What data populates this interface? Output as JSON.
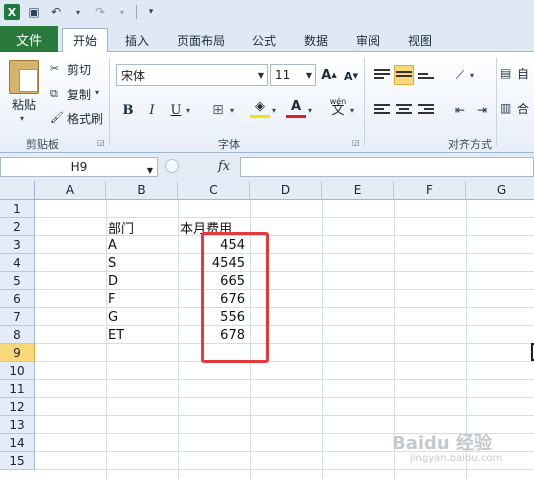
{
  "quick_access": {
    "app_icon": "X"
  },
  "tabs": [
    {
      "label": "文件"
    },
    {
      "label": "开始"
    },
    {
      "label": "插入"
    },
    {
      "label": "页面布局"
    },
    {
      "label": "公式"
    },
    {
      "label": "数据"
    },
    {
      "label": "审阅"
    },
    {
      "label": "视图"
    }
  ],
  "ribbon": {
    "clipboard": {
      "paste": "粘贴",
      "cut": "剪切",
      "copy": "复制",
      "format_painter": "格式刷",
      "group": "剪贴板"
    },
    "font": {
      "name": "宋体",
      "size": "11",
      "group": "字体",
      "bold": "B",
      "italic": "I",
      "underline": "U",
      "grow": "A",
      "shrink": "A",
      "wen": "wén",
      "wen_char": "文",
      "font_color": "A"
    },
    "alignment": {
      "group": "对齐方式",
      "auto": "自",
      "merge": "合"
    }
  },
  "formula_bar": {
    "name_box": "H9",
    "fx": "fx",
    "value": ""
  },
  "sheet": {
    "columns": [
      "A",
      "B",
      "C",
      "D",
      "E",
      "F",
      "G"
    ],
    "rows": [
      "1",
      "2",
      "3",
      "4",
      "5",
      "6",
      "7",
      "8",
      "9",
      "10",
      "11",
      "12",
      "13",
      "14",
      "15"
    ],
    "active_row": "9",
    "headers": {
      "dept": "部门",
      "cost": "本月费用"
    },
    "records": [
      {
        "dept": "A",
        "cost": "454"
      },
      {
        "dept": "S",
        "cost": "4545"
      },
      {
        "dept": "D",
        "cost": "665"
      },
      {
        "dept": "F",
        "cost": "676"
      },
      {
        "dept": "G",
        "cost": "556"
      },
      {
        "dept": "ET",
        "cost": "678"
      }
    ]
  },
  "watermark": {
    "brand": "Baidu 经验",
    "url": "jingyan.baidu.com"
  },
  "colors": {
    "highlight": "#e5393b",
    "file_tab": "#2a7a3b"
  }
}
